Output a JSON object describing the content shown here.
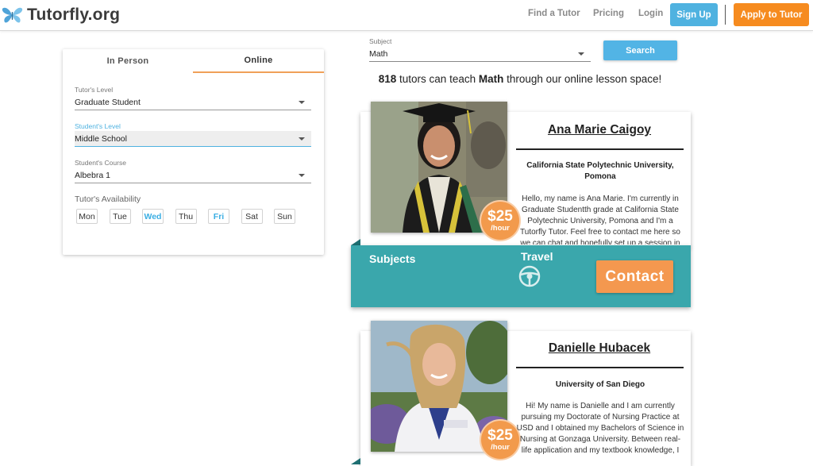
{
  "header": {
    "logo_text": "Tutorfly.org",
    "nav": {
      "find_tutor": "Find a Tutor",
      "pricing": "Pricing",
      "login": "Login",
      "signup": "Sign Up",
      "apply": "Apply to Tutor"
    }
  },
  "filters": {
    "tabs": [
      {
        "label": "In Person"
      },
      {
        "label": "Online"
      }
    ],
    "tutor_level": {
      "label": "Tutor's Level",
      "value": "Graduate Student"
    },
    "student_level": {
      "label": "Student's Level",
      "value": "Middle School"
    },
    "student_course": {
      "label": "Student's Course",
      "value": "Albebra 1"
    },
    "availability": {
      "label": "Tutor's Availability",
      "days": [
        {
          "label": "Mon",
          "selected": false
        },
        {
          "label": "Tue",
          "selected": false
        },
        {
          "label": "Wed",
          "selected": true
        },
        {
          "label": "Thu",
          "selected": false
        },
        {
          "label": "Fri",
          "selected": true
        },
        {
          "label": "Sat",
          "selected": false
        },
        {
          "label": "Sun",
          "selected": false
        }
      ]
    }
  },
  "search": {
    "subject_label": "Subject",
    "subject_value": "Math",
    "button": "Search",
    "summary_count": "818",
    "summary_pre": " tutors can teach ",
    "summary_subject": "Math",
    "summary_post": " through our online lesson space!"
  },
  "tutors": [
    {
      "name": "Ana Marie Caigoy",
      "school": "California State Polytechnic University, Pomona",
      "bio": "Hello, my name is Ana Marie. I'm currently in Graduate Studentth grade at California State Polytechnic University, Pomona and I'm a Tutorfly Tutor. Feel free to contact me here so we can chat and hopefully set up a session in",
      "price": "$25",
      "price_unit": "/hour",
      "subjects_label": "Subjects",
      "travel_label": "Travel",
      "contact": "Contact"
    },
    {
      "name": "Danielle Hubacek",
      "school": "University of San Diego",
      "bio": "Hi! My name is Danielle and I am currently pursuing my Doctorate of Nursing Practice at USD and I obtained my Bachelors of Science in Nursing at Gonzaga University. Between real-life application and my textbook knowledge, I",
      "price": "$25",
      "price_unit": "/hour"
    }
  ],
  "colors": {
    "brand_blue": "#4fb2e0",
    "brand_orange": "#f68b1f",
    "teal": "#3aa7ac"
  }
}
